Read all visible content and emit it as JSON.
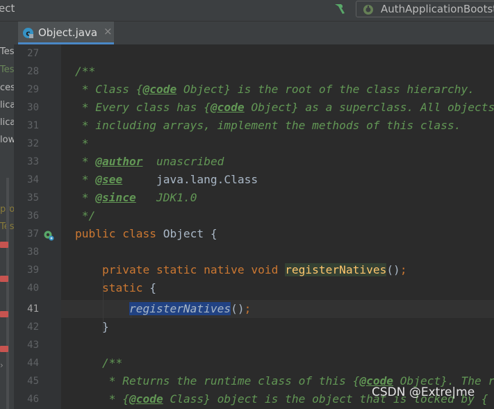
{
  "topbar": {
    "project_fragment": "ect",
    "run_config": "AuthApplicationBootst"
  },
  "left_panel": {
    "fragments": [
      "Tes",
      "Tes",
      "ces",
      "lica",
      "lica",
      "low",
      "pro",
      "Tes"
    ]
  },
  "tab": {
    "label": "Object.java",
    "close": "×"
  },
  "gutter": {
    "line_numbers": [
      "27",
      "28",
      "29",
      "30",
      "31",
      "32",
      "33",
      "34",
      "35",
      "36",
      "37",
      "38",
      "39",
      "40",
      "41",
      "42",
      "43",
      "44",
      "45",
      "46"
    ],
    "current_line": "41"
  },
  "code": {
    "l27": "",
    "l28": "/**",
    "l29_a": " * Class {",
    "l29_tag": "@code",
    "l29_b": " Object} is the root of the class hierarchy.",
    "l30_a": " * Every class has {",
    "l30_tag": "@code",
    "l30_b": " Object} as a superclass. All objects,",
    "l31": " * including arrays, implement the methods of this class.",
    "l32": " *",
    "l33_a": " * ",
    "l33_tag": "@author",
    "l33_b": "  unascribed",
    "l34_a": " * ",
    "l34_tag": "@see",
    "l34_b": "     java.lang.Class",
    "l35_a": " * ",
    "l35_tag": "@since",
    "l35_b": "   JDK1.0",
    "l36": " */",
    "l37_kw": "public class",
    "l37_rest": " Object {",
    "l39_indent": "    ",
    "l39_kw": "private static native void",
    "l39_sp": " ",
    "l39_fn": "registerNatives",
    "l39_paren": "()",
    "l39_semi": ";",
    "l40_indent": "    ",
    "l40_kw": "static",
    "l40_rest": " {",
    "l41_indent": "        ",
    "l41_call": "registerNatives",
    "l41_paren": "()",
    "l41_semi": ";",
    "l42": "    }",
    "l44": "    /**",
    "l45_a": "     * Returns the runtime class of this {",
    "l45_tag": "@code",
    "l45_b": " Object}. The returned",
    "l46_a": "     * {",
    "l46_tag": "@code",
    "l46_b": " Class} object is the object that is locked by {"
  },
  "watermark": "CSDN @Extre|me",
  "colors": {
    "comment": "#629755",
    "keyword": "#cc7832",
    "plain": "#a9b7c6",
    "method_decl": "#ffc66d",
    "selection": "#214283",
    "tab_underline": "#4a88c7"
  }
}
